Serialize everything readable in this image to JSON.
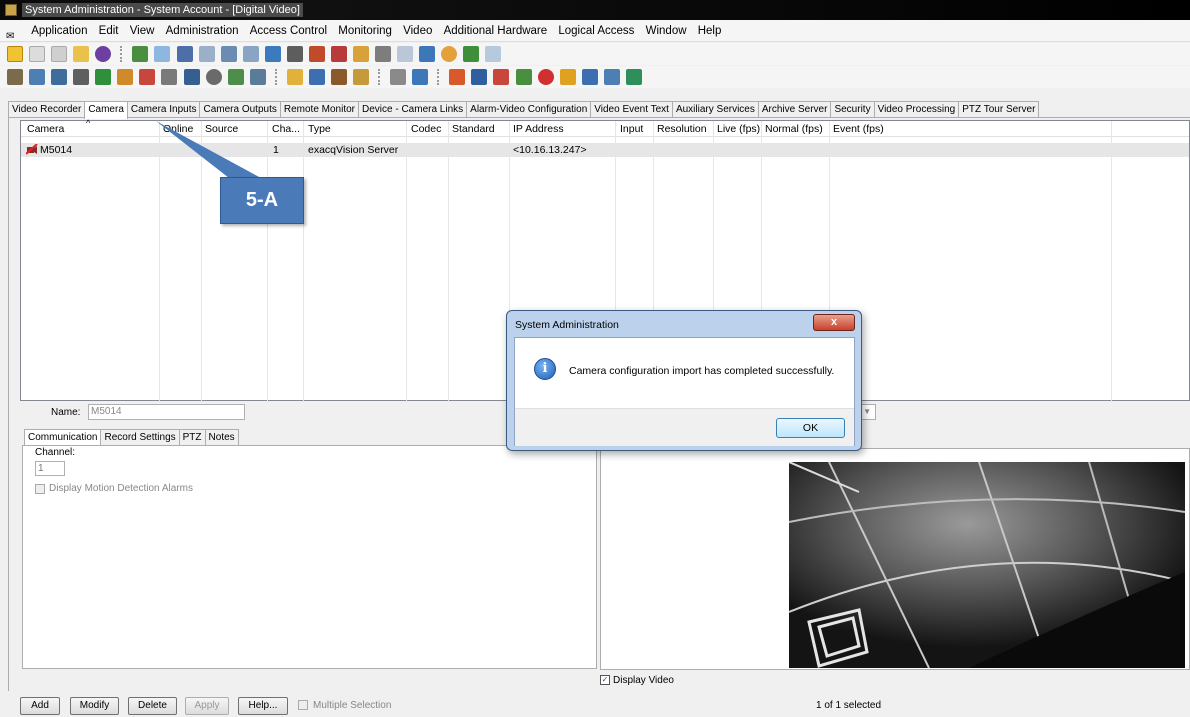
{
  "window": {
    "title": "System Administration - System Account - [Digital Video]"
  },
  "menu": [
    "Application",
    "Edit",
    "View",
    "Administration",
    "Access Control",
    "Monitoring",
    "Video",
    "Additional Hardware",
    "Logical Access",
    "Window",
    "Help"
  ],
  "tabs": [
    "Video Recorder",
    "Camera",
    "Camera Inputs",
    "Camera Outputs",
    "Remote Monitor",
    "Device - Camera Links",
    "Alarm-Video Configuration",
    "Video Event Text",
    "Auxiliary Services",
    "Archive Server",
    "Security",
    "Video Processing",
    "PTZ Tour Server"
  ],
  "active_tab": "Camera",
  "grid": {
    "columns": [
      "Camera",
      "Online",
      "Source",
      "Cha...",
      "Type",
      "Codec",
      "Standard",
      "IP Address",
      "Input",
      "Resolution",
      "Live (fps)",
      "Normal (fps)",
      "Event (fps)"
    ],
    "rows": [
      {
        "camera": "M5014",
        "channel": "1",
        "type": "exacqVision Server",
        "ip": "<10.16.13.247>"
      }
    ]
  },
  "form": {
    "name_label": "Name:",
    "name_value": "M5014",
    "subtabs": [
      "Communication",
      "Record Settings",
      "PTZ",
      "Notes"
    ],
    "channel_label": "Channel:",
    "channel_value": "1",
    "motion_label": "Display Motion Detection Alarms",
    "display_video_label": "Display Video",
    "display_video_checked": true
  },
  "buttons": {
    "add": "Add",
    "modify": "Modify",
    "delete": "Delete",
    "apply": "Apply",
    "help": "Help...",
    "multiple_selection": "Multiple Selection"
  },
  "status": {
    "selected": "1 of 1 selected"
  },
  "dialog": {
    "title": "System Administration",
    "message": "Camera configuration import has completed successfully.",
    "ok": "OK",
    "close_glyph": "x",
    "info_glyph": "i"
  },
  "callout": {
    "label": "5-A"
  },
  "colors": {
    "callout": "#4a7ab8",
    "selected_row": "#e6e6e6",
    "dialog_frame": "#bcd2ec"
  }
}
